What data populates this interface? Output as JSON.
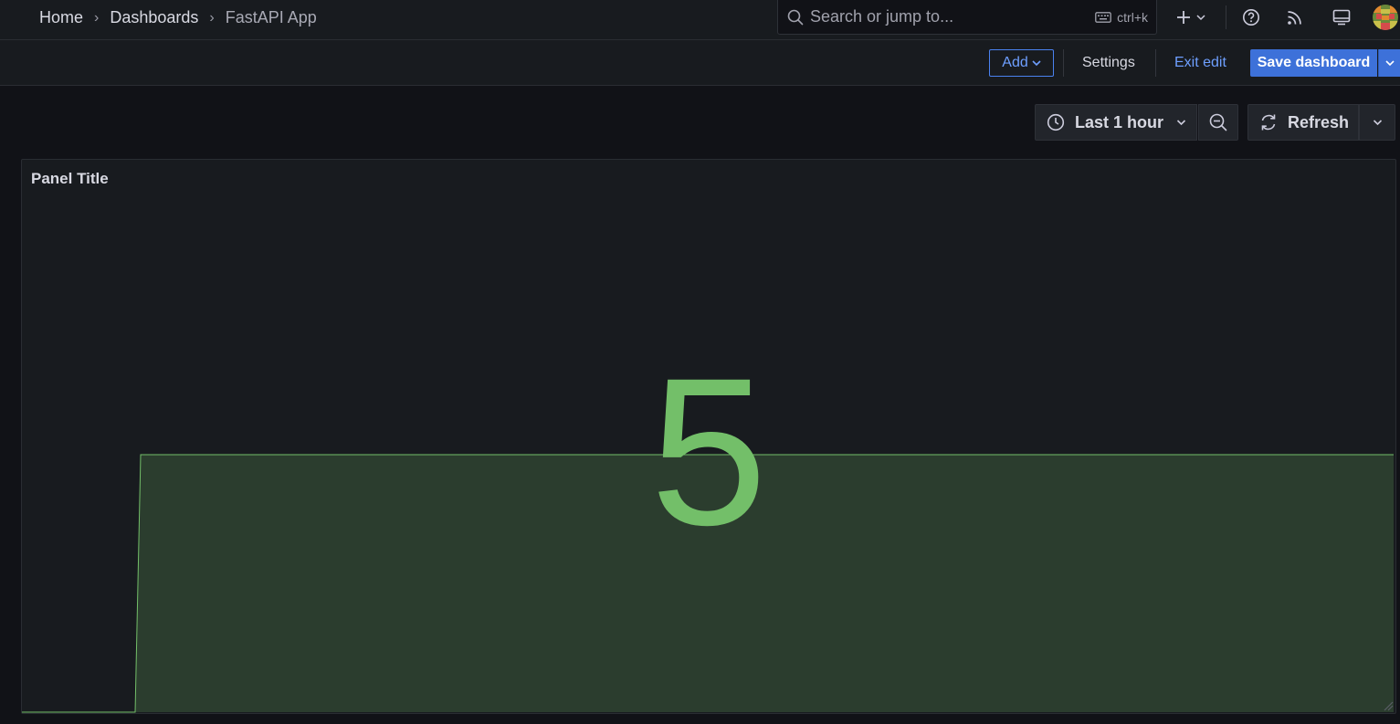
{
  "breadcrumbs": [
    "Home",
    "Dashboards",
    "FastAPI App"
  ],
  "search": {
    "placeholder": "Search or jump to...",
    "shortcut": "ctrl+k"
  },
  "toolbar_icons": [
    "plus-icon",
    "chevron-down-icon",
    "help-icon",
    "rss-icon",
    "kiosk-icon",
    "avatar"
  ],
  "edit_bar": {
    "add_label": "Add",
    "settings_label": "Settings",
    "exit_label": "Exit edit",
    "save_label": "Save dashboard"
  },
  "controls": {
    "time_range": "Last 1 hour",
    "refresh_label": "Refresh"
  },
  "panel": {
    "title": "Panel Title",
    "value": "5",
    "value_color": "#73bf69",
    "sparkline": {
      "series": [
        0,
        0,
        5,
        5
      ]
    }
  },
  "colors": {
    "background": "#111217",
    "bar": "#181b1f",
    "accent": "#3d71d9",
    "link": "#6e9fff"
  }
}
